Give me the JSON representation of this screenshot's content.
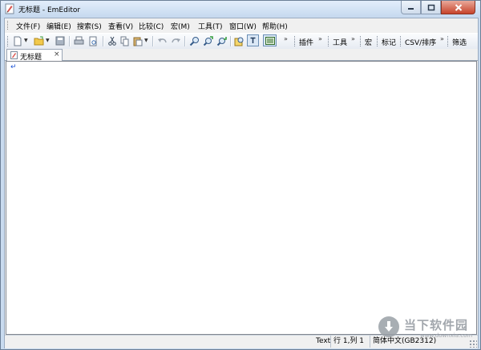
{
  "window": {
    "title": "无标题 - EmEditor",
    "buttons": {
      "minimize": "minimize",
      "maximize": "maximize",
      "close": "close"
    }
  },
  "menubar": {
    "items": [
      {
        "label": "文件(F)"
      },
      {
        "label": "编辑(E)"
      },
      {
        "label": "搜索(S)"
      },
      {
        "label": "查看(V)"
      },
      {
        "label": "比较(C)"
      },
      {
        "label": "宏(M)"
      },
      {
        "label": "工具(T)"
      },
      {
        "label": "窗口(W)"
      },
      {
        "label": "帮助(H)"
      }
    ]
  },
  "toolbar": {
    "icons": [
      "new-file-icon",
      "open-folder-icon",
      "save-icon",
      "print-icon",
      "print-preview-icon",
      "cut-icon",
      "copy-icon",
      "paste-icon",
      "undo-icon",
      "redo-icon",
      "find-icon",
      "find-next-icon",
      "find-previous-icon",
      "highlight-icon",
      "toggle-icon",
      "outline-icon"
    ],
    "chevron": "»",
    "groups": [
      {
        "label": "插件"
      },
      {
        "label": "工具"
      },
      {
        "label": "宏"
      },
      {
        "label": "标记"
      },
      {
        "label": "CSV/排序"
      },
      {
        "label": "筛选"
      }
    ]
  },
  "tabs": [
    {
      "label": "无标题",
      "close": "×"
    }
  ],
  "editor": {
    "cursor_mark": "↵"
  },
  "statusbar": {
    "mode": "Text",
    "position": "行 1,列 1",
    "encoding": "简体中文(GB2312)"
  },
  "watermark": {
    "text": "当下软件园",
    "url": "www.downxia.com"
  },
  "colors": {
    "titlebar": "#c6d9ef",
    "close_button": "#c7432b",
    "client_bg": "#f0f0f0",
    "cursor_mark": "#1a52d6"
  }
}
